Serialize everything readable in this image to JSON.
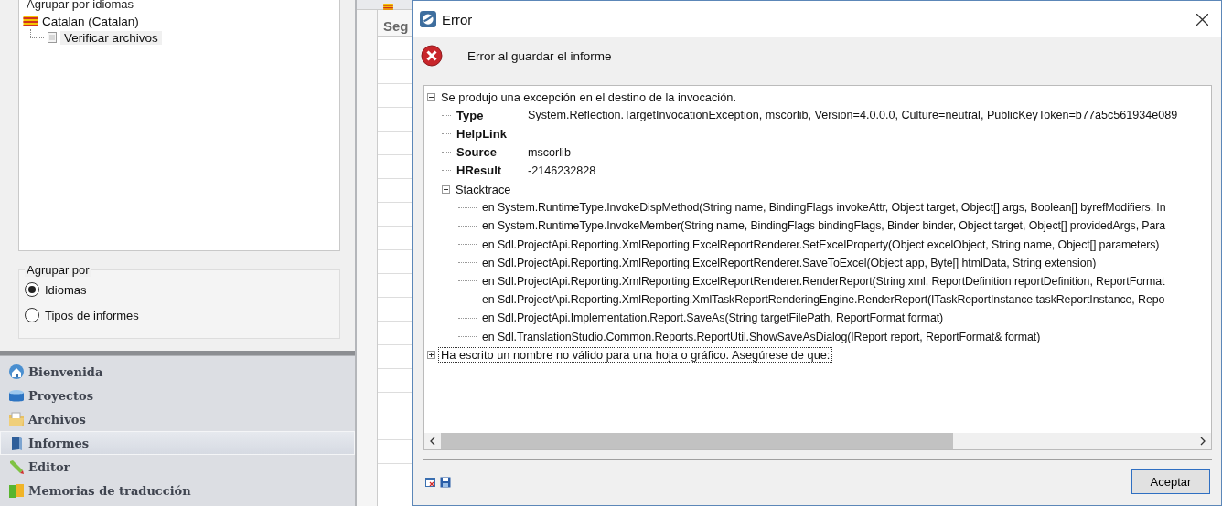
{
  "left_panel": {
    "heading": "Agrupar por idiomas",
    "tree": [
      {
        "label": "Catalan (Catalan)",
        "children": [
          {
            "label": "Verificar archivos",
            "selected": true
          }
        ]
      }
    ],
    "group_by": {
      "title": "Agrupar por",
      "options": [
        {
          "label": "Idiomas",
          "selected": true
        },
        {
          "label": "Tipos de informes",
          "selected": false
        }
      ]
    },
    "nav": [
      {
        "label": "Bienvenida",
        "kind": "home",
        "selected": false
      },
      {
        "label": "Proyectos",
        "kind": "projects",
        "selected": false
      },
      {
        "label": "Archivos",
        "kind": "files",
        "selected": false
      },
      {
        "label": "Informes",
        "kind": "reports",
        "selected": true
      },
      {
        "label": "Editor",
        "kind": "editor",
        "selected": false
      },
      {
        "label": "Memorias de traducción",
        "kind": "memories",
        "selected": false
      }
    ]
  },
  "background": {
    "column_header": "Seg"
  },
  "dialog": {
    "title": "Error",
    "message": "Error al guardar el informe",
    "tree": [
      {
        "label": "Se produjo una excepción en el destino de la invocación.",
        "expanded": true,
        "selected": false,
        "properties": [
          {
            "name": "Type",
            "value": "System.Reflection.TargetInvocationException, mscorlib, Version=4.0.0.0, Culture=neutral, PublicKeyToken=b77a5c561934e089"
          },
          {
            "name": "HelpLink"
          },
          {
            "name": "Source",
            "value": "mscorlib"
          },
          {
            "name": "HResult",
            "value": "-2146232828"
          }
        ],
        "children": [
          {
            "label": "Stacktrace",
            "expanded": true,
            "lines": [
              "en System.RuntimeType.InvokeDispMethod(String name, BindingFlags invokeAttr, Object target, Object[] args, Boolean[] byrefModifiers, In",
              "en System.RuntimeType.InvokeMember(String name, BindingFlags bindingFlags, Binder binder, Object target, Object[] providedArgs, Para",
              "en Sdl.ProjectApi.Reporting.XmlReporting.ExcelReportRenderer.SetExcelProperty(Object excelObject, String name, Object[] parameters)",
              "en Sdl.ProjectApi.Reporting.XmlReporting.ExcelReportRenderer.SaveToExcel(Object app, Byte[] htmlData, String extension)",
              "en Sdl.ProjectApi.Reporting.XmlReporting.ExcelReportRenderer.RenderReport(String xml, ReportDefinition reportDefinition, ReportFormat",
              "en Sdl.ProjectApi.Reporting.XmlReporting.XmlTaskReportRenderingEngine.RenderReport(ITaskReportInstance taskReportInstance, Repo",
              "en Sdl.ProjectApi.Implementation.Report.SaveAs(String targetFilePath, ReportFormat format)",
              "en Sdl.TranslationStudio.Common.Reports.ReportUtil.ShowSaveAsDialog(IReport report, ReportFormat& format)"
            ]
          }
        ]
      },
      {
        "label": "Ha escrito un nombre no válido para una hoja o gráfico. Asegúrese de que:",
        "expanded": false,
        "selected": true
      }
    ],
    "buttons": [
      {
        "label": "Aceptar"
      }
    ]
  }
}
